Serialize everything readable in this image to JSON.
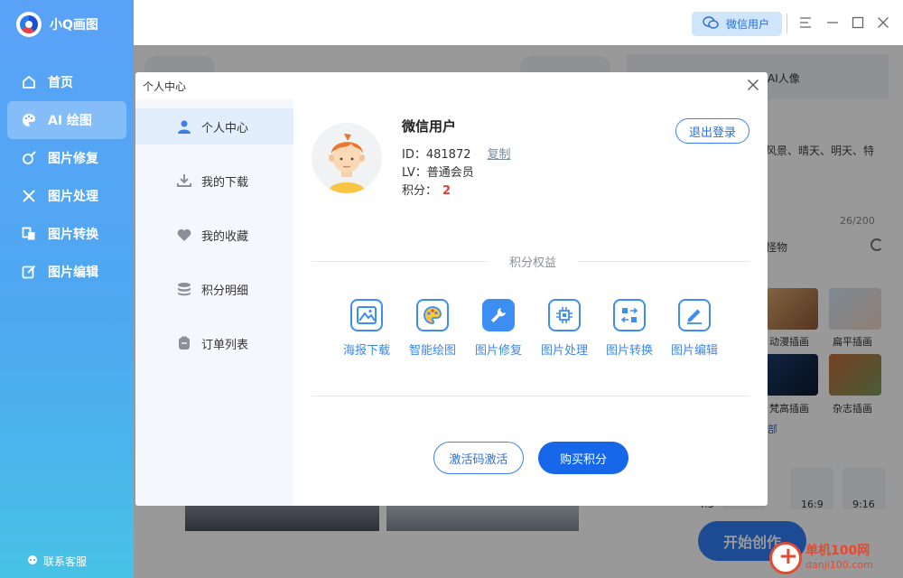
{
  "app": {
    "name": "小Q画图",
    "support": "联系客服"
  },
  "sidebar": {
    "items": [
      {
        "label": "首页",
        "icon": "home-icon"
      },
      {
        "label": "AI 绘图",
        "icon": "palette-icon",
        "active": true
      },
      {
        "label": "图片修复",
        "icon": "repair-icon"
      },
      {
        "label": "图片处理",
        "icon": "tools-icon"
      },
      {
        "label": "图片转换",
        "icon": "convert-icon"
      },
      {
        "label": "图片编辑",
        "icon": "edit-icon"
      }
    ]
  },
  "topbar": {
    "user_label": "微信用户"
  },
  "background": {
    "tab_ai_portrait": "AI人像",
    "prompt_text": "风景、晴天、明天、特",
    "char_count": "26/200",
    "style_label": "怪物",
    "thumbs": [
      "动漫插画",
      "扁平插画",
      "梵高插画",
      "杂志插画"
    ],
    "expand": "部",
    "ratios": [
      "4:3",
      "16:9",
      "9:16"
    ],
    "start_button": "开始创作"
  },
  "dialog": {
    "title": "个人中心",
    "menu": [
      {
        "label": "个人中心",
        "icon": "person-icon",
        "active": true
      },
      {
        "label": "我的下载",
        "icon": "download-icon"
      },
      {
        "label": "我的收藏",
        "icon": "heart-icon"
      },
      {
        "label": "积分明细",
        "icon": "database-icon"
      },
      {
        "label": "订单列表",
        "icon": "order-icon"
      }
    ],
    "user": {
      "name": "微信用户",
      "id_label": "ID：",
      "id_value": "481872",
      "copy_label": "复制",
      "lv_label": "LV：",
      "lv_value": "普通会员",
      "points_label": "积分：",
      "points_value": "2"
    },
    "logout_label": "退出登录",
    "section_title": "积分权益",
    "benefits": [
      {
        "label": "海报下载",
        "icon": "image-icon"
      },
      {
        "label": "智能绘图",
        "icon": "palette-icon"
      },
      {
        "label": "图片修复",
        "icon": "wrench-icon"
      },
      {
        "label": "图片处理",
        "icon": "chip-icon"
      },
      {
        "label": "图片转换",
        "icon": "convert-icon"
      },
      {
        "label": "图片编辑",
        "icon": "pencil-icon"
      }
    ],
    "activate_label": "激活码激活",
    "buy_label": "购买积分"
  },
  "watermark": {
    "main": "单机100网",
    "sub": "danji100.com"
  },
  "colors": {
    "accent": "#1667e9",
    "sidebar_top": "#5aa2f8",
    "sidebar_bottom": "#47c2e6",
    "points": "#e23b3b"
  }
}
